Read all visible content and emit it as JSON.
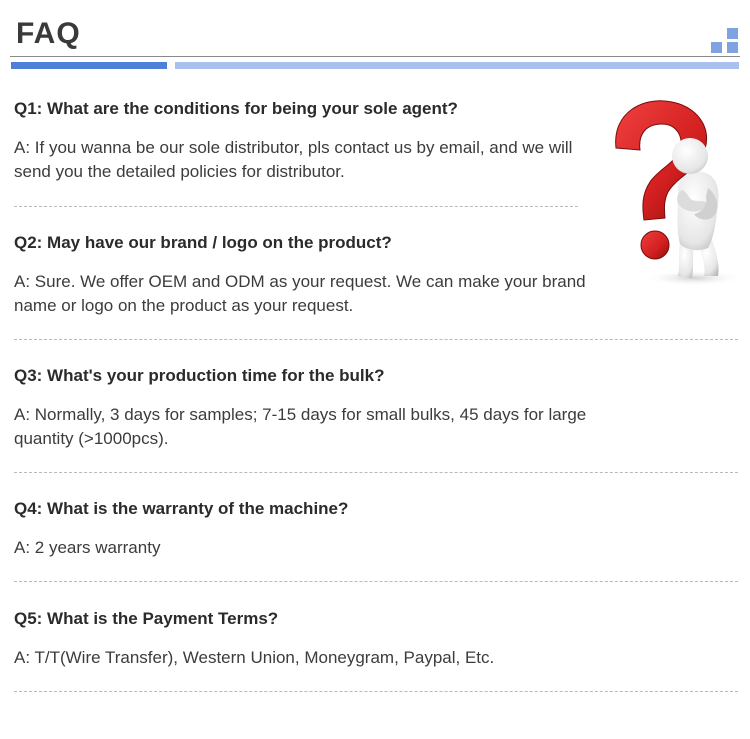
{
  "header": {
    "title": "FAQ",
    "accent_dark": "#4f7fd6",
    "accent_light": "#a9c1ec",
    "square_color": "#7fa3e0"
  },
  "faqs": [
    {
      "question": "Q1: What are the conditions for being your sole agent?",
      "answer": "A: If you wanna be our sole distributor, pls contact us by email, and we will send you the detailed policies for distributor."
    },
    {
      "question": "Q2: May have our brand / logo on the product?",
      "answer": "A: Sure. We offer OEM and ODM as your request. We can make your brand name or logo on the product as your request."
    },
    {
      "question": "Q3: What's your production time for the bulk?",
      "answer": "A: Normally, 3 days for samples; 7-15 days for small bulks, 45 days for large quantity (>1000pcs)."
    },
    {
      "question": "Q4: What is the warranty of the machine?",
      "answer": "A: 2 years warranty"
    },
    {
      "question": "Q5: What is the Payment Terms?",
      "answer": "A: T/T(Wire Transfer), Western Union, Moneygram, Paypal, Etc."
    }
  ],
  "illustration": {
    "icon": "question-mark-thinking-figure",
    "mark_color": "#d21f1f"
  }
}
